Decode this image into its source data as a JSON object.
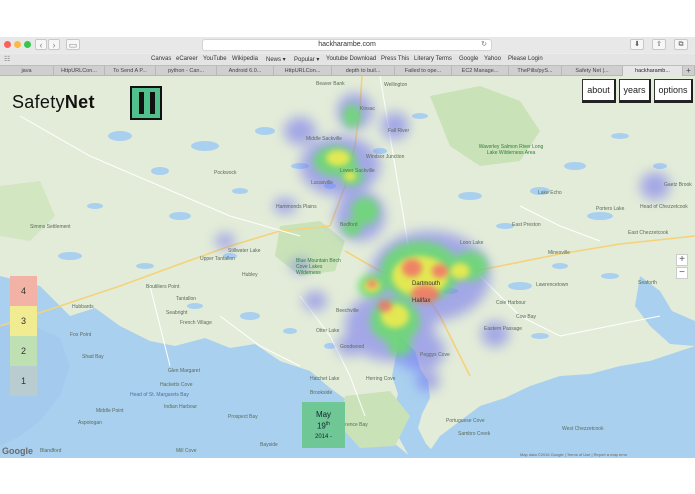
{
  "browser": {
    "url": "hackharambe.com",
    "bookmarks": [
      "Canvas",
      "eCareer",
      "YouTube",
      "Wikipedia",
      "News ▾",
      "Popular ▾",
      "Youtube Download",
      "Press This",
      "Literary Terms",
      "Google",
      "Yahoo",
      "Please Login"
    ],
    "tabs": [
      "java",
      "HttpURLCon...",
      "To Send A P...",
      "python - Can...",
      "Android 6.0...",
      "HttpURLCon...",
      "depth to buil...",
      "Failed to ope...",
      "EC2 Manage...",
      "ThePills/pyS...",
      "Safety Net |...",
      "hackharamb..."
    ],
    "active_tab": 11
  },
  "app": {
    "logo_text_a": "Safety",
    "logo_text_b": "Net",
    "nav": {
      "about": "about",
      "years": "years",
      "options": "options"
    },
    "legend": [
      {
        "label": "4",
        "color": "#f3b2a6"
      },
      {
        "label": "3",
        "color": "#f1eb92"
      },
      {
        "label": "2",
        "color": "#bfe0b3"
      },
      {
        "label": "1",
        "color": "#b9cdd1"
      }
    ],
    "date": {
      "month": "May",
      "day": "19",
      "suffix": "th",
      "year": "2014 -"
    },
    "zoom_in": "+",
    "zoom_out": "−"
  },
  "map": {
    "places": {
      "beaver_bank": "Beaver Bank",
      "wellington": "Wellington",
      "kinsac": "Kinsac",
      "fall_river": "Fall River",
      "middle_sackville": "Middle Sackville",
      "lower_sackville": "Lower Sackville",
      "windsor_junction": "Windsor Junction",
      "lucasville": "Lucasville",
      "waverley": "Waverley Salmon River Long Lake Wilderness Area",
      "gaetz_brook": "Gaetz Brook",
      "pockwock": "Pockwock",
      "lake_echo": "Lake Echo",
      "porters_lake": "Porters Lake",
      "hammonds_plains": "Hammonds Plains",
      "bedford": "Bedford",
      "head_of_chezzetcook": "Head of Chezzetcook",
      "east_preston": "East Preston",
      "west_chezzetcook": "West Chezzetcook",
      "simms_settlement": "Simms Settlement",
      "loon_lake": "Loon Lake",
      "east_chezzetcook": "East Chezzetcook",
      "upper_tantallon": "Upper Tantallon",
      "stillwater_lake": "Stillwater Lake",
      "blue_mountain": "Blue Mountain Birch Cove Lakes Wilderness",
      "minesville": "Minesville",
      "lawrencetown": "Lawrencetown",
      "dartmouth": "Dartmouth",
      "hubley": "Hubley",
      "boutiliers_point": "Boutiliers Point",
      "tantallon": "Tantallon",
      "cole_harbour": "Cole Harbour",
      "seaforth": "Seaforth",
      "halifax": "Halifax",
      "hubbards": "Hubbards",
      "head_of_st_margarets": "Head of St. Margarets Bay",
      "beechville": "Beechville",
      "cow_bay": "Cow Bay",
      "seabright": "Seabright",
      "french_village": "French Village",
      "fox_point": "Fox Point",
      "goodwood": "Goodwood",
      "eastern_passage": "Eastern Passage",
      "glen_margaret": "Glen Margaret",
      "peggys_cove": "Peggys Cove",
      "otter_lake": "Otter Lake",
      "shad_bay": "Shad Bay",
      "hackett_cove": "Hacketts Cove",
      "hatchet_lake": "Hatchet Lake",
      "herring_cove": "Herring Cove",
      "portuguese_cove": "Portuguese Cove",
      "indian_harbour": "Indian Harbour",
      "brookside": "Brookside",
      "middleton": "Middle Point",
      "aspotogan": "Aspotogan",
      "prospect_bay": "Prospect Bay",
      "terence_bay": "Terence Bay",
      "sambro": "Sambro Creek",
      "bayside": "Bayside",
      "mill_cove": "Mill Cove",
      "blandford": "Blandford"
    },
    "attribution": "Map data ©2016 Google  |  Terms of Use  |  Report a map error",
    "google_logo": "Google"
  }
}
